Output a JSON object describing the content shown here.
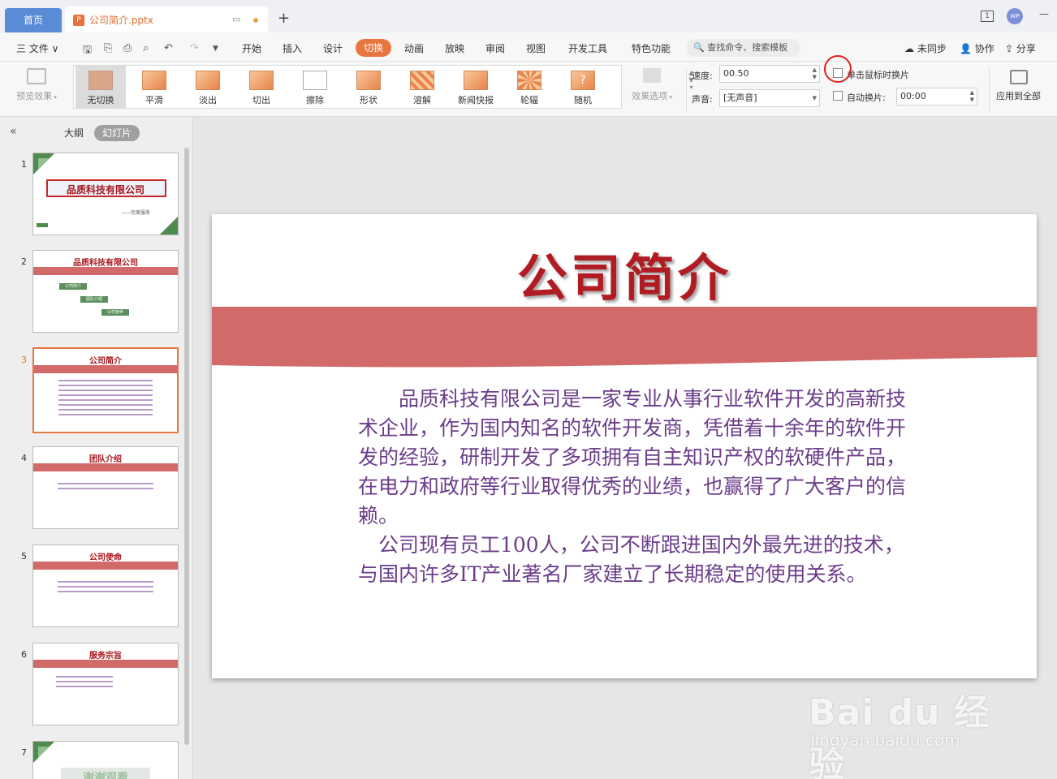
{
  "titlebar": {
    "home_tab": "首页",
    "file_tab": "公司简介.pptx",
    "add_tab": "+",
    "window_count": "1",
    "avatar": "WP",
    "minimize": "—"
  },
  "menubar": {
    "file_menu": "三 文件 ∨",
    "items": [
      "开始",
      "插入",
      "设计",
      "切换",
      "动画",
      "放映",
      "审阅",
      "视图",
      "开发工具",
      "特色功能"
    ],
    "active_index": 3,
    "search_placeholder": "查找命令、搜索模板",
    "right": {
      "sync": "未同步",
      "collab": "协作",
      "share": "分享"
    }
  },
  "ribbon": {
    "preview": "预览效果",
    "transitions": [
      "无切换",
      "平滑",
      "淡出",
      "切出",
      "擦除",
      "形状",
      "溶解",
      "新闻快报",
      "轮辐",
      "随机"
    ],
    "selected_transition": 0,
    "effect_options": "效果选项",
    "speed_label": "速度:",
    "speed_value": "00.50",
    "sound_label": "声音:",
    "sound_value": "[无声音]",
    "on_click_label": "单击鼠标时换片",
    "auto_label": "自动换片:",
    "auto_value": "00:00",
    "apply_all": "应用到全部"
  },
  "left_panel": {
    "tab_outline": "大纲",
    "tab_slides": "幻灯片",
    "active_slide": 3,
    "thumbnails": [
      {
        "num": "1",
        "title": "品质科技有限公司",
        "sub": "——完美服务"
      },
      {
        "num": "2",
        "title": "品质科技有限公司",
        "items": [
          "公司简介",
          "团队介绍",
          "公司使命"
        ]
      },
      {
        "num": "3",
        "title": "公司简介"
      },
      {
        "num": "4",
        "title": "团队介绍"
      },
      {
        "num": "5",
        "title": "公司使命"
      },
      {
        "num": "6",
        "title": "服务宗旨"
      },
      {
        "num": "7",
        "title": "谢谢观看"
      }
    ]
  },
  "slide": {
    "title": "公司简介",
    "paragraphs": [
      "　　品质科技有限公司是一家专业从事行业软件开发的高新技术企业，作为国内知名的软件开发商，凭借着十余年的软件开发的经验，研制开发了多项拥有自主知识产权的软硬件产品，在电力和政府等行业取得优秀的业绩，也赢得了广大客户的信赖。",
      "　公司现有员工100人，公司不断跟进国内外最先进的技术，与国内许多IT产业著名厂家建立了长期稳定的使用关系。"
    ]
  },
  "watermark": {
    "logo": "Bai du 经验",
    "url": "jingyan.baidu.com"
  },
  "colors": {
    "accent_orange": "#e8763f",
    "title_red": "#b01c22",
    "band_red": "#d26a6a",
    "body_purple": "#6b3d8a",
    "home_blue": "#5a8bd6"
  }
}
